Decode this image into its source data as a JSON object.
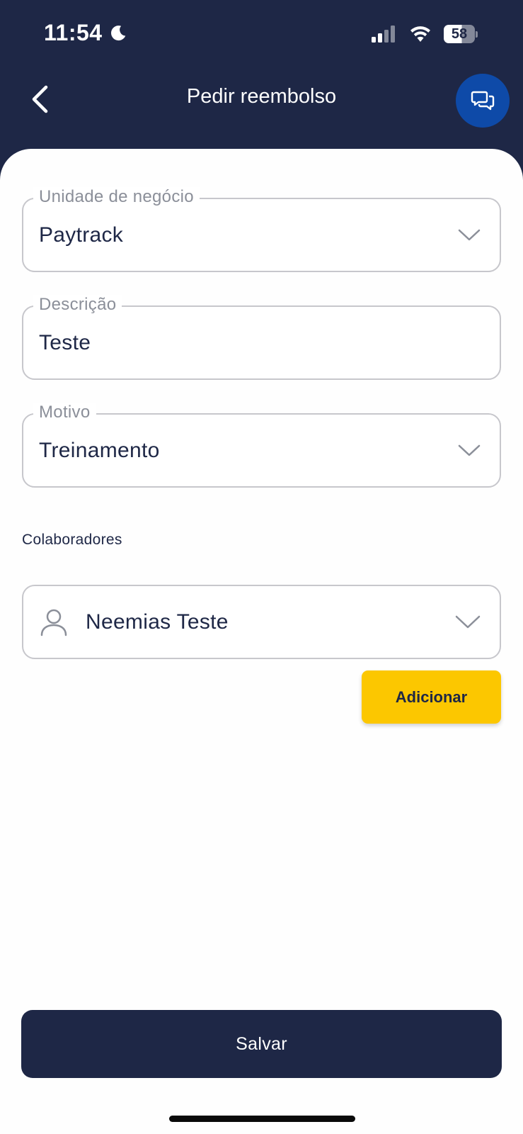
{
  "status_bar": {
    "time": "11:54",
    "battery": "58",
    "icons": [
      "moon-icon",
      "cellular-signal-icon",
      "wifi-icon",
      "battery-icon"
    ]
  },
  "header": {
    "title": "Pedir reembolso",
    "back_icon": "chevron-left-icon",
    "chat_icon": "chat-bubbles-icon"
  },
  "form": {
    "business_unit": {
      "label": "Unidade de negócio",
      "value": "Paytrack"
    },
    "description": {
      "label": "Descrição",
      "value": "Teste"
    },
    "reason": {
      "label": "Motivo",
      "value": "Treinamento"
    },
    "collaborators_label": "Colaboradores",
    "collaborator": {
      "value": "Neemias Teste"
    },
    "add_button": "Adicionar"
  },
  "footer": {
    "save_button": "Salvar"
  },
  "colors": {
    "primary_dark": "#1e2746",
    "accent_blue": "#0e4aa8",
    "accent_yellow": "#fcc700",
    "label_gray": "#8b8f99",
    "border_gray": "#c7c7cc"
  }
}
